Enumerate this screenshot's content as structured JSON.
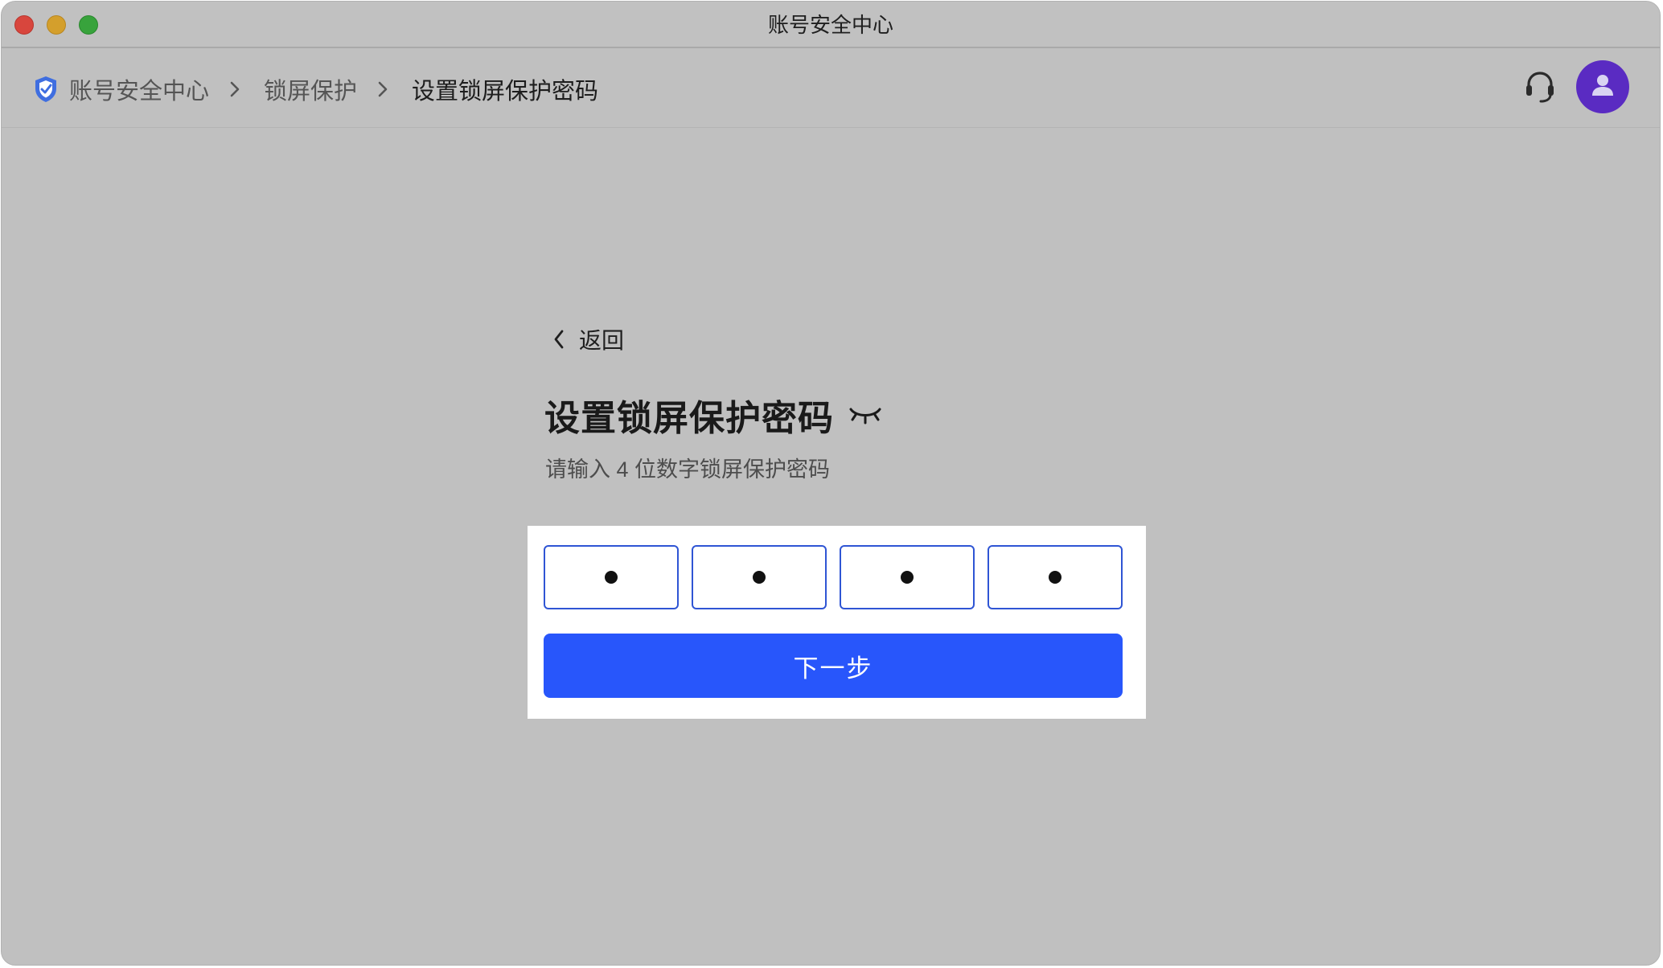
{
  "window": {
    "title": "账号安全中心"
  },
  "header": {
    "breadcrumb": [
      {
        "label": "账号安全中心"
      },
      {
        "label": "锁屏保护"
      },
      {
        "label": "设置锁屏保护密码"
      }
    ],
    "icons": {
      "brand": "shield-icon",
      "support": "headset-icon",
      "avatar": "user-icon"
    }
  },
  "main": {
    "back_label": "返回",
    "title": "设置锁屏保护密码",
    "subtitle": "请输入 4 位数字锁屏保护密码",
    "pin": {
      "length": 4,
      "filled": [
        true,
        true,
        true,
        true
      ],
      "visibility_icon": "eye-closed-icon"
    },
    "next_label": "下一步"
  },
  "colors": {
    "window_bg": "#c0c0c0",
    "primary": "#2856fb",
    "pin_border": "#2f55d4",
    "avatar_bg": "#5a2bc2",
    "close": "#d8463d",
    "minimize": "#d49f2c",
    "maximize": "#38a33c"
  }
}
